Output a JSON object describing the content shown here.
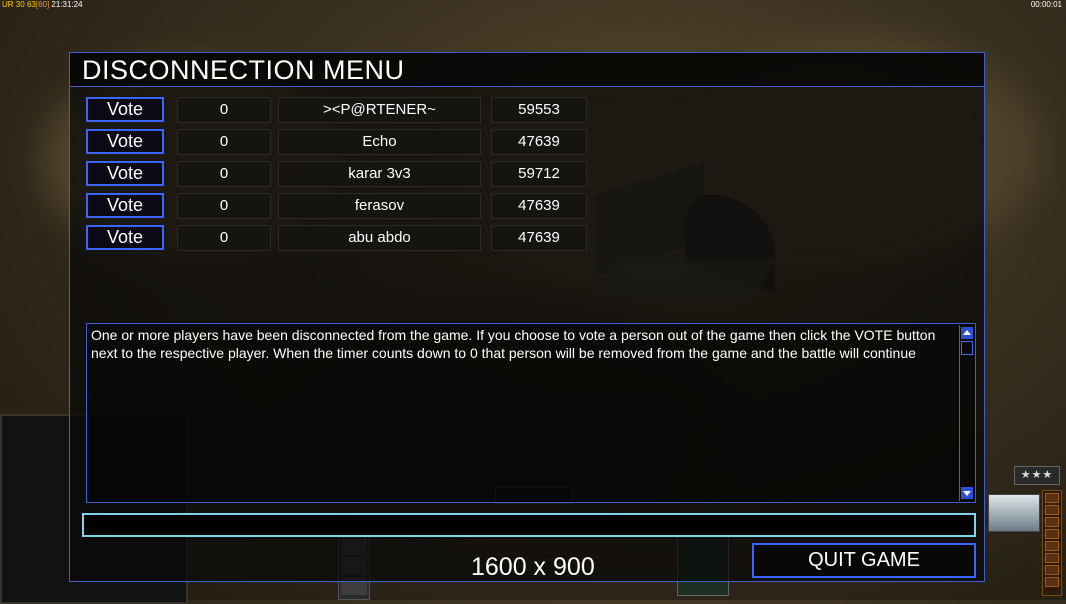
{
  "hud": {
    "top_left_a": "UR",
    "top_left_b": "30",
    "top_left_c": "63",
    "top_left_d": "[60]",
    "top_left_time": "21:31:24",
    "top_right_time": "00:00:01",
    "rank_stars": "★★★"
  },
  "dialog": {
    "title": "DISCONNECTION MENU",
    "vote_label": "Vote",
    "players": [
      {
        "count": "0",
        "name": "><P@RTENER~",
        "ping": "59553"
      },
      {
        "count": "0",
        "name": "Echo",
        "ping": "47639"
      },
      {
        "count": "0",
        "name": "karar 3v3",
        "ping": "59712"
      },
      {
        "count": "0",
        "name": "ferasov",
        "ping": "47639"
      },
      {
        "count": "0",
        "name": "abu abdo",
        "ping": "47639"
      }
    ],
    "message": "One or more players have been disconnected from the game. If you choose to vote a person out of the game then click the VOTE button next to the respective player. When the timer counts down to 0 that person will be removed from the game and the battle will continue",
    "chat_value": "",
    "resolution": "1600 x 900",
    "quit_label": "QUIT GAME"
  },
  "colors": {
    "accent_border": "#3f5fd0",
    "button_border": "#3a66ff",
    "chat_border": "#7fd4e8"
  }
}
